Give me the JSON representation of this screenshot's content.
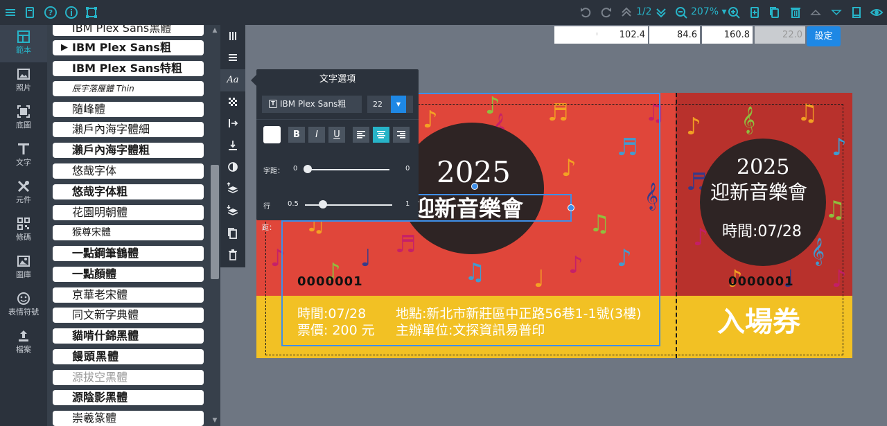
{
  "toolbar": {
    "pager": "1/2",
    "zoom": "207%"
  },
  "nav": [
    {
      "label": "範本",
      "icon": "template-icon"
    },
    {
      "label": "照片",
      "icon": "photo-icon"
    },
    {
      "label": "底圖",
      "icon": "background-icon"
    },
    {
      "label": "文字",
      "icon": "text-icon"
    },
    {
      "label": "元件",
      "icon": "element-icon"
    },
    {
      "label": "條碼",
      "icon": "barcode-icon"
    },
    {
      "label": "圖庫",
      "icon": "gallery-icon"
    },
    {
      "label": "表情符號",
      "icon": "emoji-icon"
    },
    {
      "label": "檔案",
      "icon": "file-icon"
    }
  ],
  "fonts": [
    {
      "label": "IBM Plex Sans黑體",
      "bold": false
    },
    {
      "label": "IBM Plex Sans粗",
      "bold": false,
      "selected": true
    },
    {
      "label": "IBM Plex Sans特粗",
      "bold": true
    },
    {
      "label": "辰宇落雁體 Thin",
      "bold": false
    },
    {
      "label": "隨峰體",
      "bold": false
    },
    {
      "label": "瀨戶內海字體細",
      "bold": false
    },
    {
      "label": "瀨戶內海字體粗",
      "bold": true
    },
    {
      "label": "悠哉字体",
      "bold": false
    },
    {
      "label": "悠哉字体粗",
      "bold": true
    },
    {
      "label": "花園明朝體",
      "bold": false
    },
    {
      "label": "猴尊宋體",
      "bold": false
    },
    {
      "label": "一點鋼筆鶴體",
      "bold": true
    },
    {
      "label": "一點顏體",
      "bold": true
    },
    {
      "label": "京華老宋體",
      "bold": false
    },
    {
      "label": "同文新字典體",
      "bold": false
    },
    {
      "label": "貓啃什錦黑體",
      "bold": true
    },
    {
      "label": "饅頭黑體",
      "bold": true
    },
    {
      "label": "源拔空黑體",
      "bold": false
    },
    {
      "label": "源陰影黑體",
      "bold": true
    },
    {
      "label": "崇羲篆體",
      "bold": false
    }
  ],
  "text_options": {
    "title": "文字選項",
    "font_name": "IBM Plex Sans粗",
    "font_size": "22",
    "text_color": "#ffffff",
    "letter_spacing_label": "字距：",
    "letter_spacing_min": "0",
    "letter_spacing_max": "0",
    "line_spacing_label": "行",
    "line_spacing_label2": "距：",
    "line_spacing_min": "0.5",
    "line_spacing_max": "1",
    "letter_spacing_value": 0,
    "line_spacing_value": 0.5,
    "bold_label": "B",
    "italic_label": "I",
    "underline_label": "U"
  },
  "position": {
    "x": "0",
    "y": "102.4",
    "w": "84.6",
    "h": "160.8",
    "disabled_value": "22.0",
    "set_label": "設定"
  },
  "ticket": {
    "year": "2025",
    "event": "迎新音樂會",
    "serial": "0000001",
    "time": "時間:07/28",
    "price": "票價: 200 元",
    "venue": "地點:新北市新莊區中正路56巷1-1號(3樓)",
    "organizer": "主辦單位:文探資訊易普印",
    "stub_year": "2025",
    "stub_event": "迎新音樂會",
    "stub_time": "時間:07/28",
    "stub_serial": "0000001",
    "stub_label": "入場券"
  },
  "colors": {
    "accent": "#27b4c8",
    "primary": "#1e88e5",
    "ticket_red": "#e0463a",
    "ticket_yellow": "#f2c124"
  }
}
